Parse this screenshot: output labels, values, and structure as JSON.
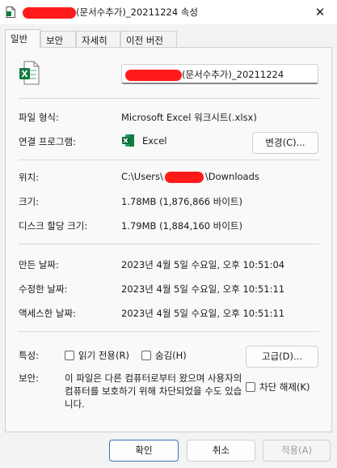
{
  "titlebar": {
    "title_suffix": "(문서수추가)_20211224 속성",
    "close_glyph": "✕"
  },
  "tabs": [
    {
      "label": "일반"
    },
    {
      "label": "보안"
    },
    {
      "label": "자세히"
    },
    {
      "label": "이전 버전"
    }
  ],
  "general": {
    "file_name_suffix": "(문서수추가)_20211224",
    "file_type_label": "파일 형식:",
    "file_type_value": "Microsoft Excel 워크시트(.xlsx)",
    "opens_with_label": "연결 프로그램:",
    "opens_with_value": "Excel",
    "change_button": "변경(C)...",
    "location_label": "위치:",
    "location_prefix": "C:\\Users\\",
    "location_suffix": "\\Downloads",
    "size_label": "크기:",
    "size_value": "1.78MB (1,876,866 바이트)",
    "size_on_disk_label": "디스크 할당 크기:",
    "size_on_disk_value": "1.79MB (1,884,160 바이트)",
    "created_label": "만든 날짜:",
    "created_value": "2023년 4월 5일 수요일, 오후 10:51:04",
    "modified_label": "수정한 날짜:",
    "modified_value": "2023년 4월 5일 수요일, 오후 10:51:11",
    "accessed_label": "액세스한 날짜:",
    "accessed_value": "2023년 4월 5일 수요일, 오후 10:51:11",
    "attributes_label": "특성:",
    "readonly_label": "읽기 전용(R)",
    "hidden_label": "숨김(H)",
    "advanced_button": "고급(D)...",
    "security_label": "보안:",
    "security_text": "이 파일은 다른 컴퓨터로부터 왔으며 사용자의 컴퓨터를 보호하기 위해 차단되었을 수도 있습니다.",
    "unblock_label": "차단 해제(K)"
  },
  "footer": {
    "ok_button": "확인",
    "cancel_button": "취소",
    "apply_button": "적용(A)"
  },
  "colors": {
    "excel_green": "#107c41",
    "redaction": "#ff1a1a",
    "primary_border": "#3d6fb6"
  }
}
